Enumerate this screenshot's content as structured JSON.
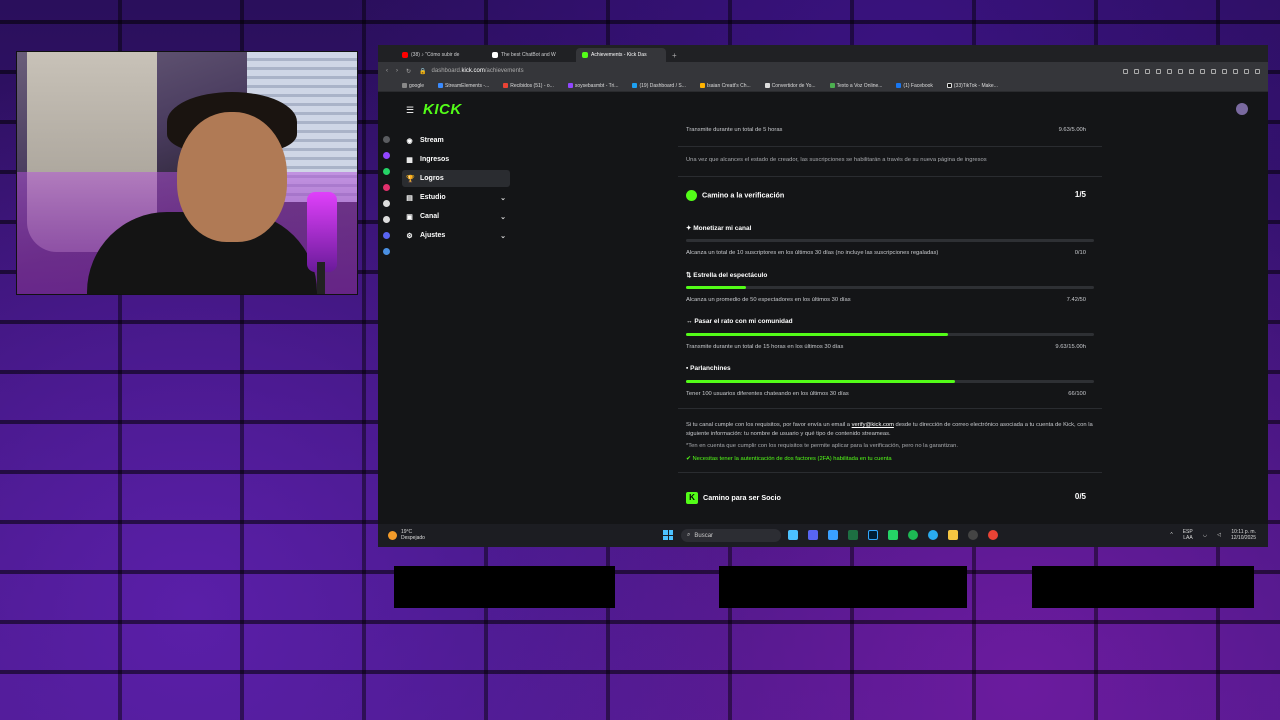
{
  "browser": {
    "tabs": [
      {
        "label": "(38) ♪ \"Cómo subir de",
        "color": "#ff0000",
        "active": false
      },
      {
        "label": "The best ChatBot and W",
        "color": "#ffffff",
        "active": false
      },
      {
        "label": "Achievements - Kick Das",
        "color": "#53fc18",
        "active": true
      }
    ],
    "url_prefix": "dashboard.",
    "url_host": "kick.com",
    "url_path": "/achievements",
    "bookmarks": [
      "google",
      "StreamElements -...",
      "Recibidos (51) - o...",
      "soysebasmbt - Tri...",
      "(19) Dashboard / S...",
      "Isaian Creatt's Ch...",
      "Convertidor de Yo...",
      "Texto a Voz Online...",
      "(1) Facebook",
      "(33)TikTok - Make..."
    ]
  },
  "kick": {
    "logo": "KICK",
    "nav": [
      {
        "label": "Stream",
        "icon": "◉",
        "active": false,
        "expandable": false
      },
      {
        "label": "Ingresos",
        "icon": "▦",
        "active": false,
        "expandable": false
      },
      {
        "label": "Logros",
        "icon": "🏆",
        "active": true,
        "expandable": false
      },
      {
        "label": "Estudio",
        "icon": "▤",
        "active": false,
        "expandable": true
      },
      {
        "label": "Canal",
        "icon": "▣",
        "active": false,
        "expandable": true
      },
      {
        "label": "Ajustes",
        "icon": "⚙",
        "active": false,
        "expandable": true
      }
    ]
  },
  "achievements": {
    "top_item": {
      "desc": "Transmite durante un total de 5 horas",
      "value": "9.63/5.00h"
    },
    "creator_note": "Una vez que alcances el estado de creador, las suscripciones se habilitarán a través de su nueva página de ingresos",
    "verification": {
      "title": "Camino a la verificación",
      "progress": "1/5",
      "items": [
        {
          "icon": "✦",
          "name": "Monetizar mi canal",
          "desc": "Alcanza un total de 10 suscriptores en los últimos 30 días (no incluye las suscripciones regaladas)",
          "value": "0/10",
          "fraction": 0.0
        },
        {
          "icon": "⇅",
          "name": "Estrella del espectáculo",
          "desc": "Alcanza un promedio de 50 espectadores en los últimos 30 días",
          "value": "7.42/50",
          "fraction": 0.148
        },
        {
          "icon": "↔",
          "name": "Pasar el rato con mi comunidad",
          "desc": "Transmite durante un total de 15 horas en los últimos 30 días",
          "value": "9.63/15.00h",
          "fraction": 0.642
        },
        {
          "icon": "▪",
          "name": "Parlanchines",
          "desc": "Tener 100 usuarios diferentes chateando en los últimos 30 días",
          "value": "66/100",
          "fraction": 0.66
        }
      ],
      "email_text_1": "Si tu canal cumple con los requisitos, por favor envía un email a ",
      "email_link": "verify@kick.com",
      "email_text_2": " desde tu dirección de correo electrónico asociada a tu cuenta de Kick, con la siguiente información: tu nombre de usuario y qué tipo de contenido streameas.",
      "warning": "*Ten en cuenta que cumplir con los requisitos te permite aplicar para la verificación, pero no la garantizan.",
      "twofa": "Necesitas tener la autenticación de dos factores (2FA) habilitada en tu cuenta"
    },
    "partner": {
      "title": "Camino para ser Socio",
      "progress": "0/5"
    }
  },
  "taskbar": {
    "temp": "19°C",
    "weather": "Despejado",
    "search": "Buscar",
    "lang1": "ESP",
    "lang2": "LAA",
    "time": "10:11 p. m.",
    "date": "12/10/2025"
  }
}
